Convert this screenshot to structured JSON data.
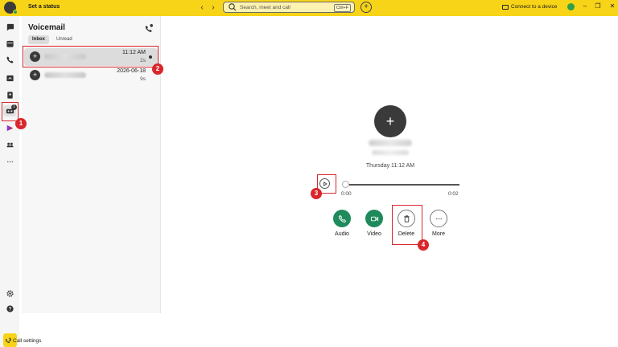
{
  "topbar": {
    "set_status": "Set a status",
    "search_placeholder": "Search, meet and call",
    "search_shortcut": "Ctrl+F",
    "connect_label": "Connect to a device"
  },
  "rail": {
    "voicemail_badge": "1"
  },
  "voicemail": {
    "title": "Voicemail",
    "tabs": [
      {
        "label": "Inbox"
      },
      {
        "label": "Unread"
      }
    ],
    "items": [
      {
        "time": "11:12 AM",
        "duration": "2s",
        "unread": true
      },
      {
        "time": "2026-06-18",
        "duration": "9s",
        "unread": false
      }
    ]
  },
  "detail": {
    "date": "Thursday 11:12 AM",
    "time_current": "0:00",
    "time_total": "0:02",
    "actions": [
      {
        "label": "Audio"
      },
      {
        "label": "Video"
      },
      {
        "label": "Delete"
      },
      {
        "label": "More"
      }
    ]
  },
  "footer": {
    "call_settings": "Call settings"
  },
  "annotations": [
    "1",
    "2",
    "3",
    "4"
  ],
  "colors": {
    "accent": "#f7d417",
    "action_green": "#1f8a5b",
    "annotation_red": "#d9262c"
  }
}
